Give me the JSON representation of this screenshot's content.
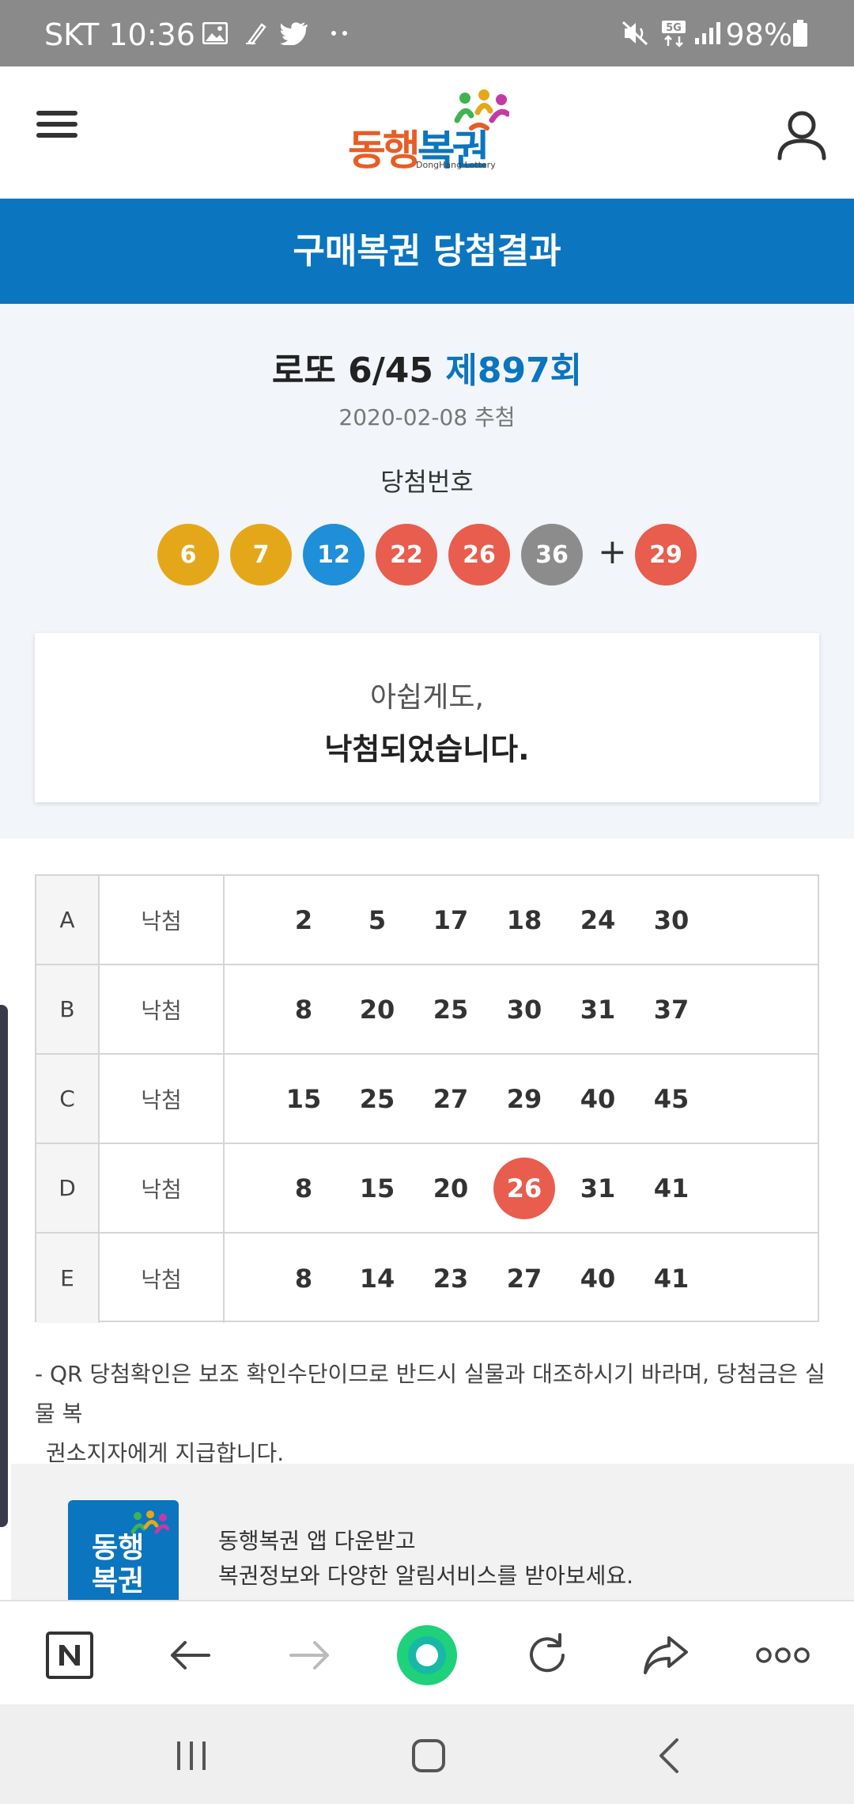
{
  "status_bar": {
    "carrier_time": "SKT 10:36",
    "battery": "98%",
    "icons": [
      "gallery-icon",
      "pen-icon",
      "twitter-icon",
      "more-dots-icon",
      "mute-icon",
      "5g-icon",
      "signal-icon",
      "battery-icon"
    ]
  },
  "header": {
    "logo_text_1": "동행",
    "logo_text_2": "복권",
    "logo_sub": "DongHang Lottery"
  },
  "title_bar": "구매복권 당첨결과",
  "draw": {
    "game": "로또 6/45",
    "round": "제897회",
    "date": "2020-02-08 추첨",
    "label": "당첨번호",
    "numbers": [
      {
        "n": "6",
        "color": "#e5a71a"
      },
      {
        "n": "7",
        "color": "#e5a71a"
      },
      {
        "n": "12",
        "color": "#1e8fd8"
      },
      {
        "n": "22",
        "color": "#e85d4e"
      },
      {
        "n": "26",
        "color": "#e85d4e"
      },
      {
        "n": "36",
        "color": "#8c8c8c"
      }
    ],
    "plus": "+",
    "bonus": {
      "n": "29",
      "color": "#e85d4e"
    }
  },
  "message": {
    "line1": "아쉽게도,",
    "line2": "낙첨되었습니다."
  },
  "games": [
    {
      "key": "A",
      "result": "낙첨",
      "nums": [
        "2",
        "5",
        "17",
        "18",
        "24",
        "30"
      ],
      "hits": [
        false,
        false,
        false,
        false,
        false,
        false
      ]
    },
    {
      "key": "B",
      "result": "낙첨",
      "nums": [
        "8",
        "20",
        "25",
        "30",
        "31",
        "37"
      ],
      "hits": [
        false,
        false,
        false,
        false,
        false,
        false
      ]
    },
    {
      "key": "C",
      "result": "낙첨",
      "nums": [
        "15",
        "25",
        "27",
        "29",
        "40",
        "45"
      ],
      "hits": [
        false,
        false,
        false,
        false,
        false,
        false
      ]
    },
    {
      "key": "D",
      "result": "낙첨",
      "nums": [
        "8",
        "15",
        "20",
        "26",
        "31",
        "41"
      ],
      "hits": [
        false,
        false,
        false,
        true,
        false,
        false
      ]
    },
    {
      "key": "E",
      "result": "낙첨",
      "nums": [
        "8",
        "14",
        "23",
        "27",
        "40",
        "41"
      ],
      "hits": [
        false,
        false,
        false,
        false,
        false,
        false
      ]
    }
  ],
  "notice": {
    "line1": "- QR 당첨확인은 보조 확인수단이므로 반드시 실물과 대조하시기 바라며, 당첨금은 실물 복",
    "line2": "권소지자에게 지급합니다."
  },
  "promo": {
    "icon_text_1": "동행",
    "icon_text_2": "복권",
    "line1": "동행복권 앱 다운받고",
    "line2": "복권정보와 다양한 알림서비스를 받아보세요."
  },
  "browser_bar": {
    "items": [
      "naver-home-icon",
      "back-arrow-icon",
      "forward-arrow-icon",
      "green-dot-icon",
      "refresh-icon",
      "share-icon",
      "more-icon"
    ]
  },
  "system_nav": [
    "recent-apps-icon",
    "home-icon",
    "back-icon"
  ]
}
